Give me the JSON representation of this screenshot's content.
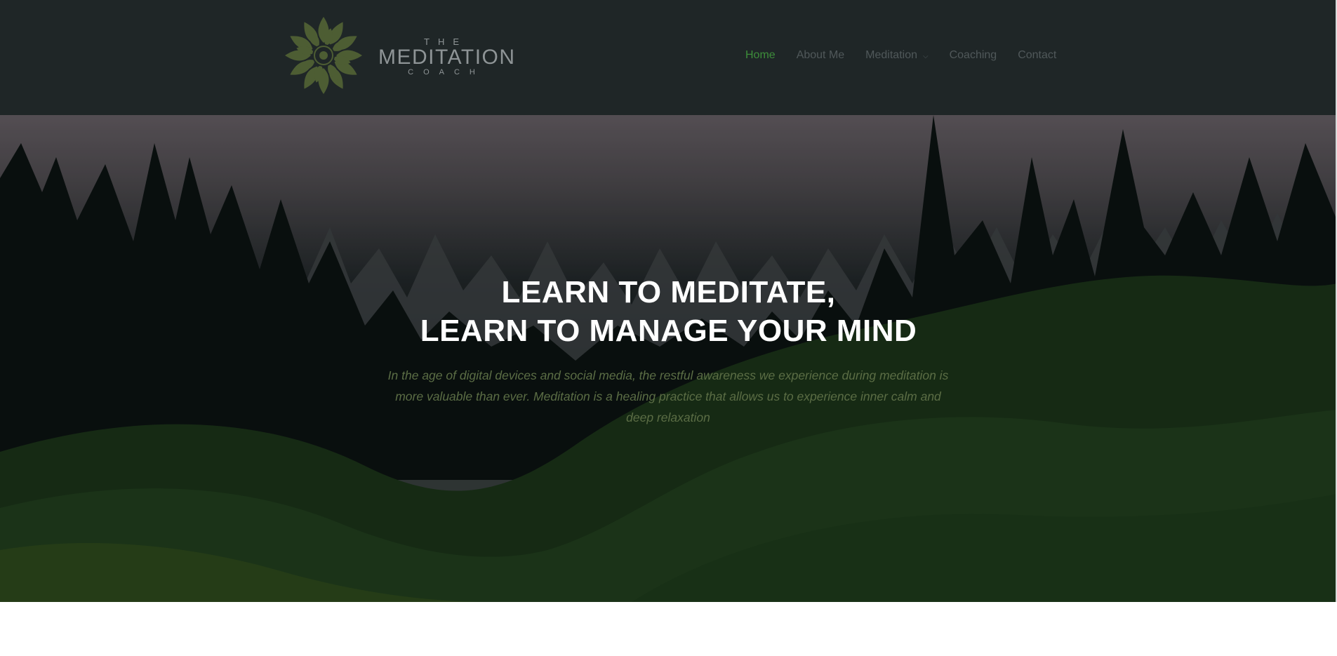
{
  "logo": {
    "line1": "THE",
    "line2": "MEDITATION",
    "line3": "COACH",
    "icon": "lotus-mandala-icon"
  },
  "nav": {
    "items": [
      {
        "label": "Home",
        "active": true
      },
      {
        "label": "About Me",
        "active": false
      },
      {
        "label": "Meditation",
        "active": false,
        "has_dropdown": true
      },
      {
        "label": "Coaching",
        "active": false
      },
      {
        "label": "Contact",
        "active": false
      }
    ],
    "dropdown_icon": "chevron-down-icon"
  },
  "hero": {
    "title_line1": "LEARN TO MEDITATE,",
    "title_line2": "LEARN TO MANAGE YOUR MIND",
    "text": "In the age of digital devices and social media, the restful awareness we experience during meditation is more valuable than ever. Meditation is a healing practice that allows us to experience inner calm and deep relaxation"
  },
  "colors": {
    "header_bg": "#1f2627",
    "nav_active": "#3d8d3a",
    "nav_inactive": "#50585a",
    "logo_green": "#4d5d33",
    "hero_text": "#5b6d45"
  }
}
